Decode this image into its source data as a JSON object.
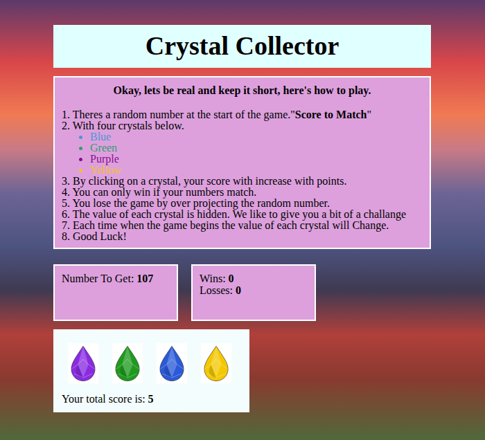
{
  "title": "Crystal Collector",
  "instructions": {
    "heading": "Okay, lets be real and keep it short, here's how to play.",
    "steps": [
      {
        "parts": [
          {
            "text": "1. Theres a random number at the start of the game.\"",
            "bold": false
          },
          {
            "text": "Score to Match",
            "bold": true
          },
          {
            "text": "\"",
            "bold": false
          }
        ],
        "bullets": []
      },
      {
        "parts": [
          {
            "text": "2. With four crystals below.",
            "bold": false
          }
        ],
        "bullets": [
          {
            "label": "Blue",
            "color": "#4a98d4"
          },
          {
            "label": "Green",
            "color": "#2f9e72"
          },
          {
            "label": "Purple",
            "color": "#8a0f8e"
          },
          {
            "label": "Yellow",
            "color": "#f2c12e"
          }
        ]
      },
      {
        "parts": [
          {
            "text": "3. By clicking on a crystal, your score with increase with points.",
            "bold": false
          }
        ],
        "bullets": []
      },
      {
        "parts": [
          {
            "text": "4. You can only win if your numbers match.",
            "bold": false
          }
        ],
        "bullets": []
      },
      {
        "parts": [
          {
            "text": "5. You lose the game by over projecting the random number.",
            "bold": false
          }
        ],
        "bullets": []
      },
      {
        "parts": [
          {
            "text": "6. The value of each crystal is hidden. We like to give you a bit of a challange",
            "bold": false
          }
        ],
        "bullets": []
      },
      {
        "parts": [
          {
            "text": "7. Each time when the game begins the value of each crystal will Change.",
            "bold": false
          }
        ],
        "bullets": []
      },
      {
        "parts": [
          {
            "text": "8. Good Luck!",
            "bold": false
          }
        ],
        "bullets": []
      }
    ]
  },
  "target": {
    "label": "Number To Get: ",
    "value": "107"
  },
  "record": [
    {
      "label": "Wins: ",
      "value": "0"
    },
    {
      "label": "Losses: ",
      "value": "0"
    }
  ],
  "crystals": [
    {
      "color": "#8a2be2"
    },
    {
      "color": "#1f9a1f"
    },
    {
      "color": "#2a5ad8"
    },
    {
      "color": "#f4c800"
    }
  ],
  "score": {
    "label": "Your total score is: ",
    "value": "5"
  }
}
